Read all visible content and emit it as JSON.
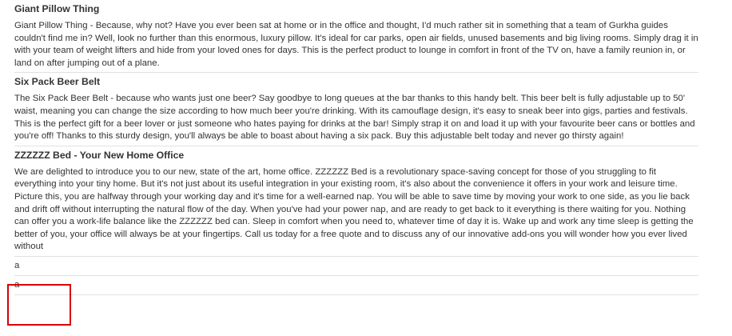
{
  "products": [
    {
      "title": "Giant Pillow Thing",
      "description": "Giant Pillow Thing - Because, why not? Have you ever been sat at home or in the office and thought, I'd much rather sit in something that a team of Gurkha guides couldn't find me in? Well, look no further than this enormous, luxury pillow. It's ideal for car parks, open air fields, unused basements and big living rooms. Simply drag it in with your team of weight lifters and hide from your loved ones for days. This is the perfect product to lounge in comfort in front of the TV on, have a family reunion in, or land on after jumping out of a plane."
    },
    {
      "title": "Six Pack Beer Belt",
      "description": "The Six Pack Beer Belt - because who wants just one beer? Say goodbye to long queues at the bar thanks to this handy belt. This beer belt is fully adjustable up to 50' waist, meaning you can change the size according to how much beer you're drinking. With its camouflage design, it's easy to sneak beer into gigs, parties and festivals. This is the perfect gift for a beer lover or just someone who hates paying for drinks at the bar! Simply strap it on and load it up with your favourite beer cans or bottles and you're off! Thanks to this sturdy design, you'll always be able to boast about having a six pack. Buy this adjustable belt today and never go thirsty again!"
    },
    {
      "title": "ZZZZZZ Bed - Your New Home Office",
      "description": "We are delighted to introduce you to our new, state of the art, home office. ZZZZZZ Bed is a revolutionary space-saving concept for those of you struggling to fit everything into your tiny home. But it's not just about its useful integration in your existing room, it's also about the convenience it offers in your work and leisure time. Picture this, you are halfway through your working day and it's time for a well-earned nap. You will be able to save time by moving your work to one side, as you lie back and drift off without interrupting the natural flow of the day. When you've had your power nap, and are ready to get back to it everything is there waiting for you. Nothing can offer you a work-life balance like the ZZZZZZ bed can. Sleep in comfort when you need to, whatever time of day it is. Wake up and work any time sleep is getting the better of you, your office will always be at your fingertips. Call us today for a free quote and to discuss any of our innovative add-ons you will wonder how you ever lived without"
    }
  ],
  "extra_rows": [
    "a",
    "a"
  ],
  "colors": {
    "text": "#333333",
    "divider": "#e1e1e1",
    "highlight_border": "#d80000"
  }
}
